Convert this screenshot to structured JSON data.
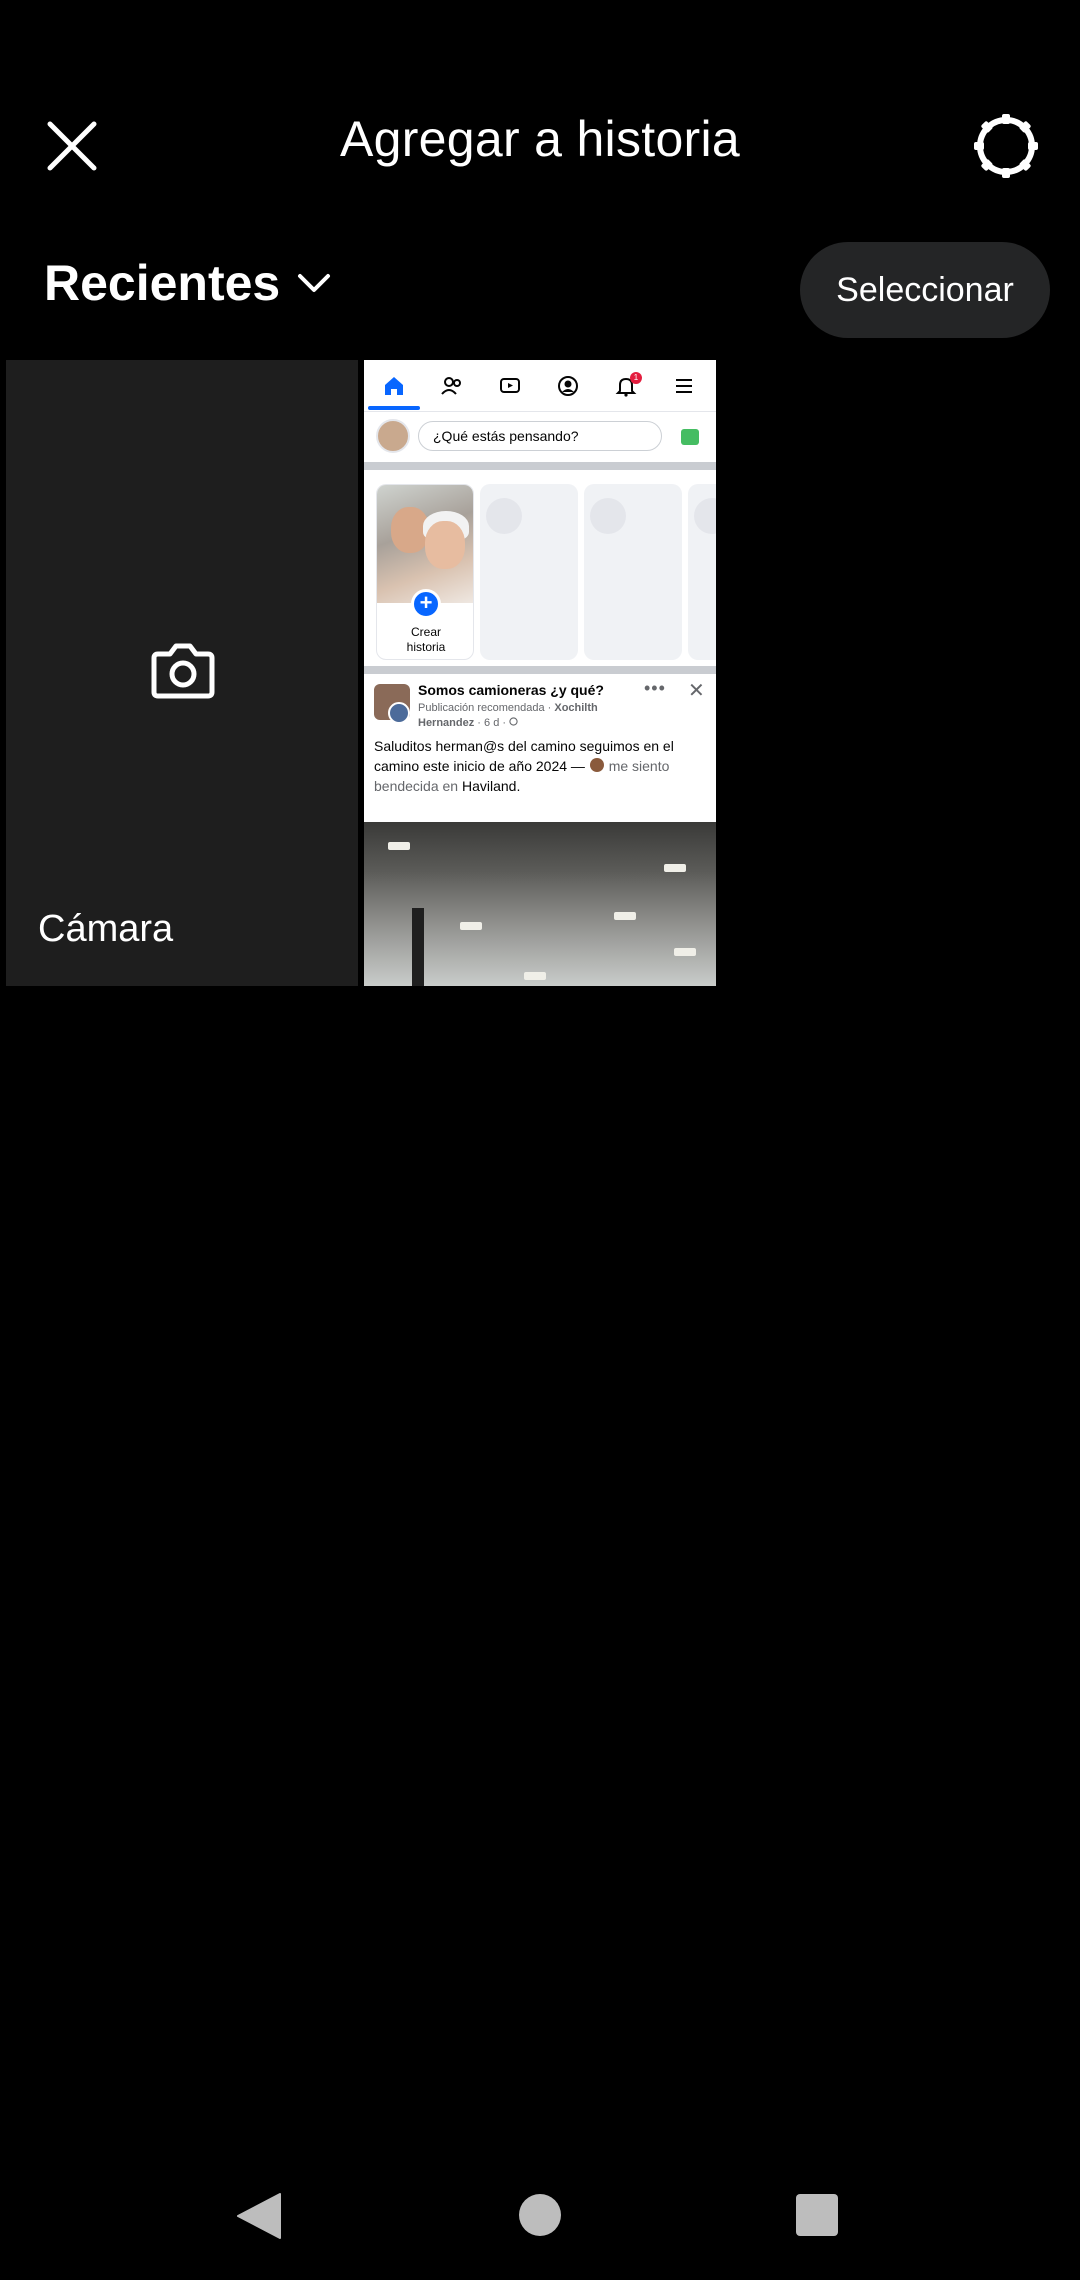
{
  "header": {
    "title": "Agregar a historia",
    "close_icon": "close-icon",
    "settings_icon": "gear-icon"
  },
  "album": {
    "label": "Recientes",
    "dropdown_icon": "chevron-down-icon",
    "select_label": "Seleccionar"
  },
  "grid": {
    "camera": {
      "label": "Cámara",
      "icon": "camera-icon"
    },
    "photo": {
      "composer_placeholder": "¿Qué estás pensando?",
      "notification_count": "1",
      "story_create_label_line1": "Crear",
      "story_create_label_line2": "historia",
      "post_group": "Somos camioneras ¿y qué?",
      "post_meta_line1": "Publicación recomendada · ",
      "post_meta_author": "Xochilth Hernandez",
      "post_meta_time": " · 6 d · ",
      "post_text_main": "Saluditos herman@s del camino seguimos en el camino este inicio de año 2024 — ",
      "post_text_feeling": " me siento bendecida en ",
      "post_text_place": "Haviland",
      "post_text_end": ".",
      "more_icon": "•••",
      "close_icon": "✕"
    }
  },
  "colors": {
    "background": "#000000",
    "tile": "#1e1e1e",
    "button_bg": "#242526",
    "fb_blue": "#0866ff"
  }
}
